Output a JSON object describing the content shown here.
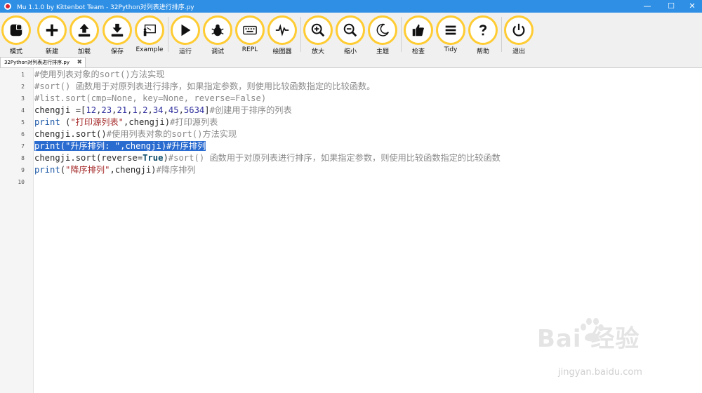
{
  "window": {
    "title": "Mu 1.1.0 by Kittenbot Team - 32Python对列表进行排序.py",
    "min_glyph": "—",
    "max_glyph": "☐",
    "close_glyph": "✕"
  },
  "toolbar": {
    "buttons": [
      {
        "id": "mode",
        "label": "模式",
        "icon": "mode-icon"
      },
      {
        "id": "new",
        "label": "新建",
        "icon": "plus-icon"
      },
      {
        "id": "load",
        "label": "加载",
        "icon": "upload-icon"
      },
      {
        "id": "save",
        "label": "保存",
        "icon": "download-icon"
      },
      {
        "id": "example",
        "label": "Example",
        "icon": "presentation-icon"
      },
      {
        "id": "run",
        "label": "运行",
        "icon": "play-icon"
      },
      {
        "id": "debug",
        "label": "调试",
        "icon": "bug-icon"
      },
      {
        "id": "repl",
        "label": "REPL",
        "icon": "keyboard-icon"
      },
      {
        "id": "plotter",
        "label": "绘图器",
        "icon": "pulse-icon"
      },
      {
        "id": "zoom-in",
        "label": "放大",
        "icon": "zoom-in-icon"
      },
      {
        "id": "zoom-out",
        "label": "缩小",
        "icon": "zoom-out-icon"
      },
      {
        "id": "theme",
        "label": "主题",
        "icon": "moon-icon"
      },
      {
        "id": "check",
        "label": "检查",
        "icon": "thumbs-up-icon"
      },
      {
        "id": "tidy",
        "label": "Tidy",
        "icon": "menu-lines-icon"
      },
      {
        "id": "help",
        "label": "帮助",
        "icon": "question-icon"
      },
      {
        "id": "quit",
        "label": "退出",
        "icon": "power-icon"
      }
    ],
    "accent_color": "#ffcc33"
  },
  "tab": {
    "label": "32Python对列表进行排序.py",
    "close_glyph": "✖"
  },
  "editor": {
    "line_numbers": [
      "1",
      "2",
      "3",
      "4",
      "5",
      "6",
      "7",
      "8",
      "9",
      "10"
    ],
    "lines": {
      "l1": "#使用列表对象的sort()方法实现",
      "l2": "#sort() 函数用于对原列表进行排序，如果指定参数，则使用比较函数指定的比较函数。",
      "l3": "#list.sort(cmp=None, key=None, reverse=False)",
      "l4_a": "chengji =[",
      "l4_b": "12",
      "l4_c": ",",
      "l4_d": "23",
      "l4_e": ",",
      "l4_f": "21",
      "l4_g": ",",
      "l4_h": "1",
      "l4_i": ",",
      "l4_j": "2",
      "l4_k": ",",
      "l4_l": "34",
      "l4_m": ",",
      "l4_n": "45",
      "l4_o": ",",
      "l4_p": "5634",
      "l4_q": "]",
      "l4_r": "#创建用于排序的列表",
      "l5_a": "print",
      "l5_b": " (",
      "l5_c": "\"打印源列表\"",
      "l5_d": ",chengji)",
      "l5_e": "#打印源列表",
      "l6_a": "chengji.sort()",
      "l6_b": "#使用列表对象的sort()方法实现",
      "l7": "print(\"升序排列: \",chengji)#升序排列",
      "l8_a": "chengji.sort(reverse=",
      "l8_b": "True",
      "l8_c": ")",
      "l8_d": "#sort() 函数用于对原列表进行排序，如果指定参数，则使用比较函数指定的比较函数",
      "l9_a": "print",
      "l9_b": "(",
      "l9_c": "\"降序排列\"",
      "l9_d": ",chengji)",
      "l9_e": "#降序排列"
    },
    "selection_color": "#2a6bd0"
  },
  "watermark": {
    "main": "Bai  经验",
    "sub": "jingyan.baidu.com"
  }
}
